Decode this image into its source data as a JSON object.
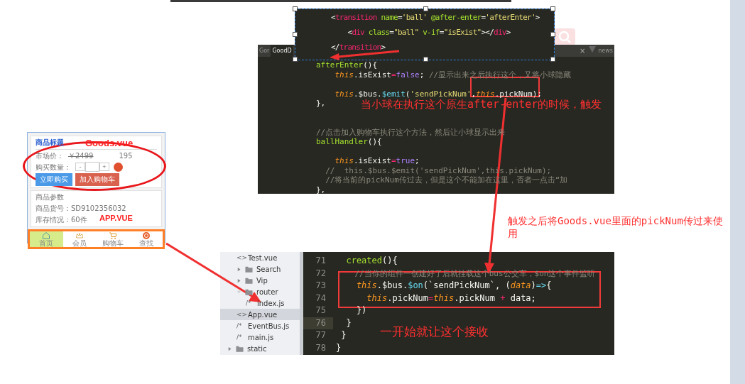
{
  "snippet_overlay": {
    "lines": [
      {
        "tokens": [
          {
            "text": "<",
            "kind": "plain"
          },
          {
            "text": "transition",
            "kind": "tag"
          },
          {
            "text": " name",
            "kind": "attr"
          },
          {
            "text": "=",
            "kind": "plain"
          },
          {
            "text": "'ball'",
            "kind": "string"
          },
          {
            "text": " @after-enter",
            "kind": "attr"
          },
          {
            "text": "=",
            "kind": "plain"
          },
          {
            "text": "'afterEnter'",
            "kind": "string"
          },
          {
            "text": ">",
            "kind": "plain"
          }
        ]
      },
      {
        "tokens": [
          {
            "text": "    <",
            "kind": "plain"
          },
          {
            "text": "div",
            "kind": "tag"
          },
          {
            "text": " class",
            "kind": "attr"
          },
          {
            "text": "=",
            "kind": "plain"
          },
          {
            "text": "\"ball\"",
            "kind": "string"
          },
          {
            "text": " v-if",
            "kind": "attr"
          },
          {
            "text": "=",
            "kind": "plain"
          },
          {
            "text": "\"isExist\"",
            "kind": "string"
          },
          {
            "text": "></",
            "kind": "plain"
          },
          {
            "text": "div",
            "kind": "tag"
          },
          {
            "text": ">",
            "kind": "plain"
          }
        ]
      },
      {
        "tokens": [
          {
            "text": "</",
            "kind": "plain"
          },
          {
            "text": "transition",
            "kind": "tag"
          },
          {
            "text": ">",
            "kind": "plain"
          }
        ]
      }
    ]
  },
  "editor_top": {
    "tabs": [
      {
        "label": "Gor",
        "selected": false
      },
      {
        "label": "GoodD",
        "selected": true
      },
      {
        "label": "news",
        "selected": false
      }
    ],
    "close_glyph": "×",
    "lines": [
      {
        "kind": "code",
        "tokens": [
          {
            "text": "afterEnter",
            "kind": "fn"
          },
          {
            "text": "(){",
            "kind": "plain"
          }
        ]
      },
      {
        "kind": "code",
        "tokens": [
          {
            "text": "    this",
            "kind": "this"
          },
          {
            "text": ".isExist",
            "kind": "plain"
          },
          {
            "text": "=",
            "kind": "op"
          },
          {
            "text": "false",
            "kind": "bool"
          },
          {
            "text": "; ",
            "kind": "plain"
          },
          {
            "text": "//显示出来之后执行这个，又将小球隐藏",
            "kind": "comment"
          }
        ]
      },
      {
        "kind": "blank"
      },
      {
        "kind": "code",
        "tokens": [
          {
            "text": "    this",
            "kind": "this"
          },
          {
            "text": ".$bus.",
            "kind": "plain"
          },
          {
            "text": "$emit",
            "kind": "method"
          },
          {
            "text": "(",
            "kind": "plain"
          },
          {
            "text": "'sendPickNum'",
            "kind": "string"
          },
          {
            "text": ",",
            "kind": "plain"
          },
          {
            "text": "this",
            "kind": "this"
          },
          {
            "text": ".pickNum);",
            "kind": "plain"
          }
        ]
      },
      {
        "kind": "code",
        "tokens": [
          {
            "text": "},",
            "kind": "plain"
          }
        ]
      },
      {
        "kind": "blank"
      },
      {
        "kind": "blank"
      },
      {
        "kind": "code",
        "tokens": [
          {
            "text": "//点击加入购物车执行这个方法，然后让小球显示出来",
            "kind": "comment"
          }
        ]
      },
      {
        "kind": "code",
        "tokens": [
          {
            "text": "ballHandler",
            "kind": "fn"
          },
          {
            "text": "(){",
            "kind": "plain"
          }
        ]
      },
      {
        "kind": "blank"
      },
      {
        "kind": "code",
        "tokens": [
          {
            "text": "    this",
            "kind": "this"
          },
          {
            "text": ".isExist",
            "kind": "plain"
          },
          {
            "text": "=",
            "kind": "op"
          },
          {
            "text": "true",
            "kind": "bool"
          },
          {
            "text": ";",
            "kind": "plain"
          }
        ]
      },
      {
        "kind": "code",
        "tokens": [
          {
            "text": "  //  this.$bus.$emit('sendPickNum',this.pickNum);",
            "kind": "comment"
          }
        ]
      },
      {
        "kind": "code",
        "tokens": [
          {
            "text": "  //将当前的pickNum传过去，但是这个不能加在这里，否者一点击“加",
            "kind": "comment"
          }
        ]
      },
      {
        "kind": "code",
        "tokens": [
          {
            "text": "},",
            "kind": "plain"
          }
        ]
      }
    ]
  },
  "annotations": [
    {
      "text": "当小球在执行这个原生after-enter的时候，触发"
    },
    {
      "text": "触发之后将Goods.vue里面的pickNum传过来使用"
    },
    {
      "text": "一开始就让这个接收"
    }
  ],
  "phone": {
    "title": "商品标题",
    "market_label": "市场价：",
    "market_price": "￥2499",
    "sale_price": "195",
    "qty_label": "购买数量：",
    "minus": "-",
    "plus": "+",
    "buttons": [
      {
        "label": "立即购买",
        "color": "#4a9ae8"
      },
      {
        "label": "加入购物车",
        "color": "#d9624f"
      }
    ],
    "params_title": "商品参数",
    "params": [
      "商品货号：SD9102356032",
      "库存情况：60件"
    ],
    "tabbar": [
      {
        "label": "首页",
        "kind": "home",
        "selected": true
      },
      {
        "label": "会员",
        "kind": "crown",
        "selected": false
      },
      {
        "label": "购物车",
        "kind": "cart",
        "selected": false
      },
      {
        "label": "查找",
        "kind": "search",
        "selected": false
      }
    ],
    "goods_label": "Goods.vue",
    "app_label": "APP.VUE"
  },
  "file_tree": {
    "items": [
      {
        "label": "Test.vue",
        "kind": "file",
        "glyph": "<>",
        "selected": false
      },
      {
        "label": "Search",
        "kind": "folder",
        "expanded": false,
        "selected": false
      },
      {
        "label": "Vip",
        "kind": "folder",
        "expanded": false,
        "selected": false
      },
      {
        "label": "router",
        "kind": "folder",
        "expanded": true,
        "selected": false,
        "children": [
          {
            "label": "index.js",
            "kind": "file",
            "glyph": "/*",
            "selected": false
          }
        ]
      },
      {
        "label": "App.vue",
        "kind": "file",
        "glyph": "<>",
        "selected": true
      },
      {
        "label": "EventBus.js",
        "kind": "file",
        "glyph": "/*",
        "selected": false
      },
      {
        "label": "main.js",
        "kind": "file",
        "glyph": "/*",
        "selected": false
      }
    ],
    "outer_items": [
      {
        "label": "static",
        "kind": "folder",
        "expanded": false,
        "selected": false
      }
    ]
  },
  "editor_bottom": {
    "lines": [
      {
        "number": "71",
        "current": false,
        "tokens": [
          {
            "text": "  created",
            "kind": "fn"
          },
          {
            "text": "(){",
            "kind": "plain"
          }
        ]
      },
      {
        "number": "72",
        "current": false,
        "tokens": [
          {
            "text": "    //当你的组件一创建好了后就挂载这个bus公交车，$on这个事件监听",
            "kind": "comment"
          }
        ]
      },
      {
        "number": "73",
        "current": false,
        "tokens": [
          {
            "text": "    this",
            "kind": "this"
          },
          {
            "text": ".$bus.",
            "kind": "plain"
          },
          {
            "text": "$on",
            "kind": "method"
          },
          {
            "text": "(`sendPickNum`, (",
            "kind": "plain"
          },
          {
            "text": "data",
            "kind": "param"
          },
          {
            "text": ")",
            "kind": "plain"
          },
          {
            "text": "=>",
            "kind": "method"
          },
          {
            "text": "{",
            "kind": "plain"
          }
        ]
      },
      {
        "number": "74",
        "current": false,
        "tokens": [
          {
            "text": "      this",
            "kind": "this"
          },
          {
            "text": ".pickNum",
            "kind": "plain"
          },
          {
            "text": "=",
            "kind": "op"
          },
          {
            "text": "this",
            "kind": "this"
          },
          {
            "text": ".pickNum ",
            "kind": "plain"
          },
          {
            "text": "+",
            "kind": "op"
          },
          {
            "text": " data;",
            "kind": "plain"
          }
        ]
      },
      {
        "number": "75",
        "current": false,
        "tokens": [
          {
            "text": "    })",
            "kind": "plain"
          }
        ]
      },
      {
        "number": "76",
        "current": true,
        "tokens": [
          {
            "text": "  }",
            "kind": "plain"
          }
        ]
      },
      {
        "number": "77",
        "current": false,
        "tokens": [
          {
            "text": " }",
            "kind": "plain"
          }
        ]
      },
      {
        "number": "78",
        "current": false,
        "tokens": [
          {
            "text": "}",
            "kind": "plain"
          }
        ]
      }
    ]
  }
}
